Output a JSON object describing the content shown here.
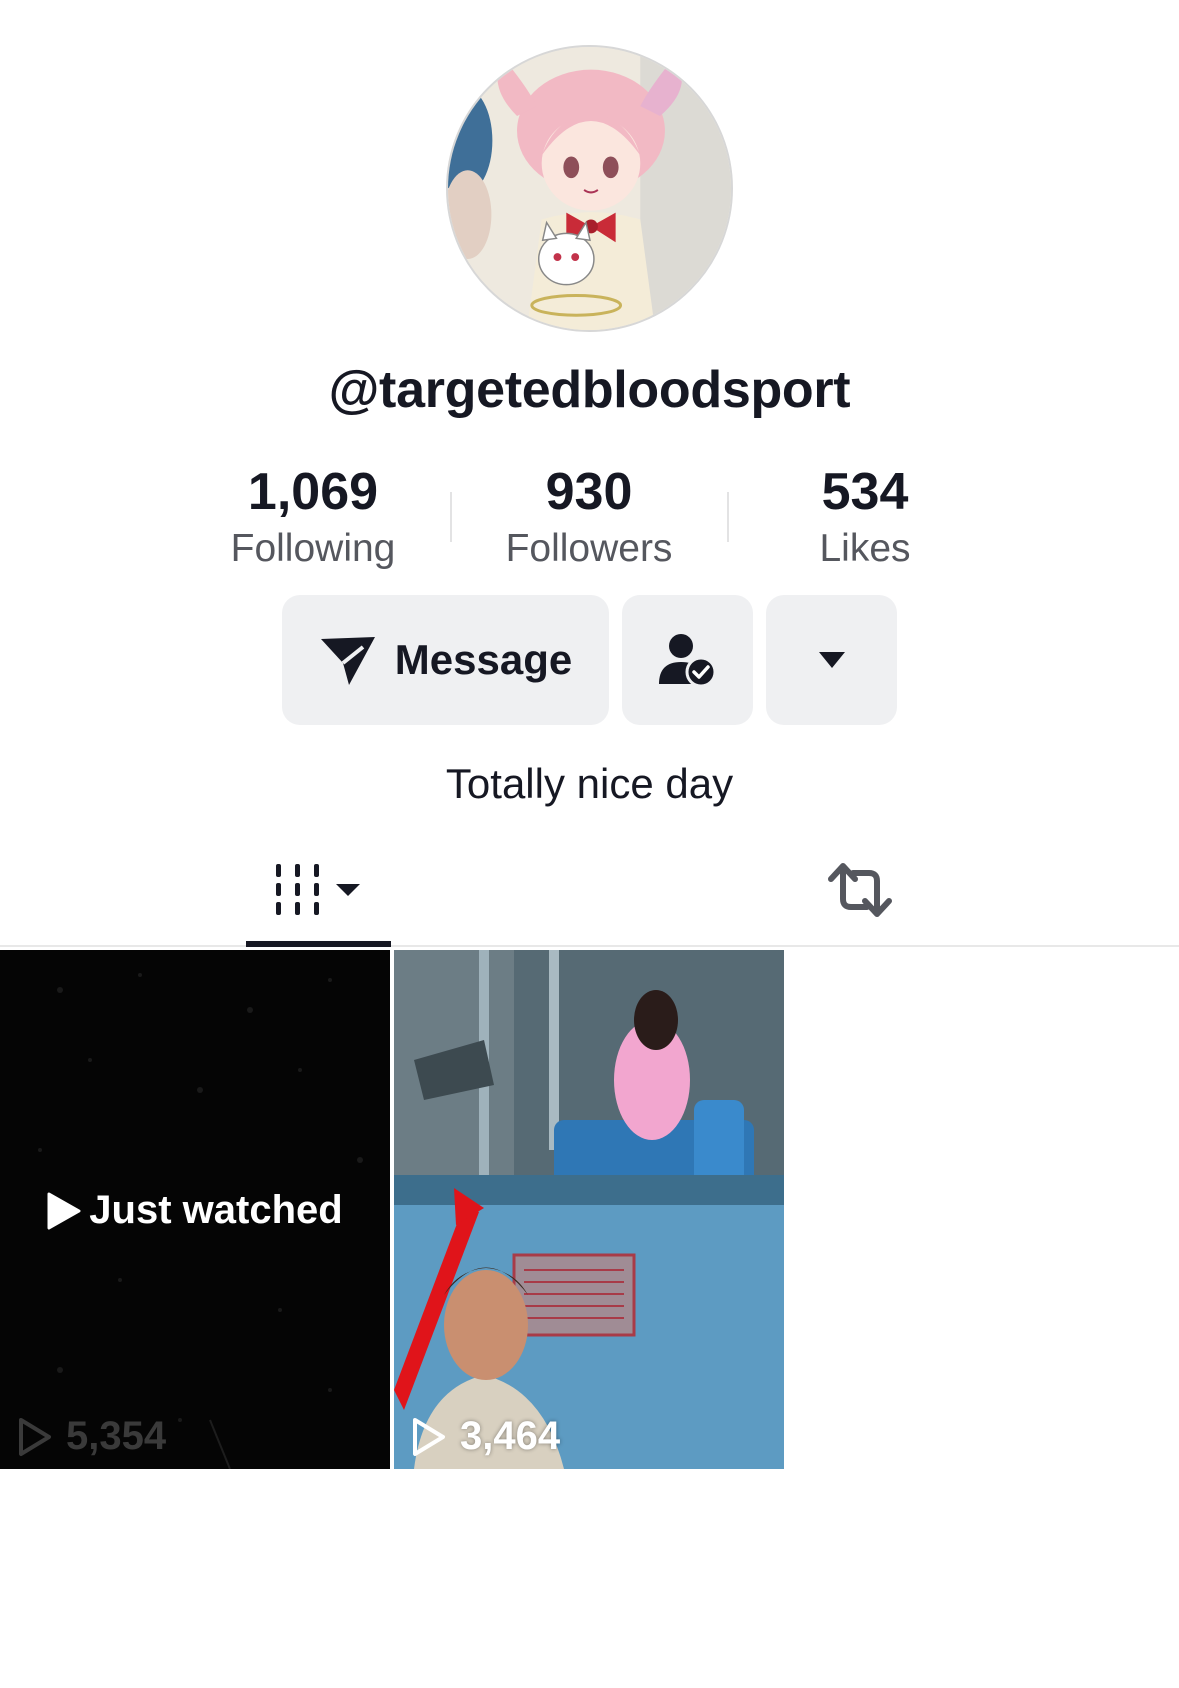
{
  "profile": {
    "username": "@targetedbloodsport",
    "bio": "Totally nice day",
    "avatar_icon": "anime-character-avatar"
  },
  "stats": [
    {
      "value": "1,069",
      "label": "Following"
    },
    {
      "value": "930",
      "label": "Followers"
    },
    {
      "value": "534",
      "label": "Likes"
    }
  ],
  "actions": {
    "message_label": "Message",
    "message_icon": "send-icon",
    "friend_icon": "user-check-icon",
    "more_icon": "caret-down-icon"
  },
  "tabs": [
    {
      "icon": "videos-grid-icon",
      "active": true
    },
    {
      "icon": "repost-icon",
      "active": false
    }
  ],
  "videos": [
    {
      "badge": "Just watched",
      "views": "5,354"
    },
    {
      "views": "3,464"
    }
  ],
  "colors": {
    "text": "#161823",
    "secondary_text": "#55575e",
    "button_bg": "#eff0f2",
    "divider": "#e3e3e4"
  }
}
